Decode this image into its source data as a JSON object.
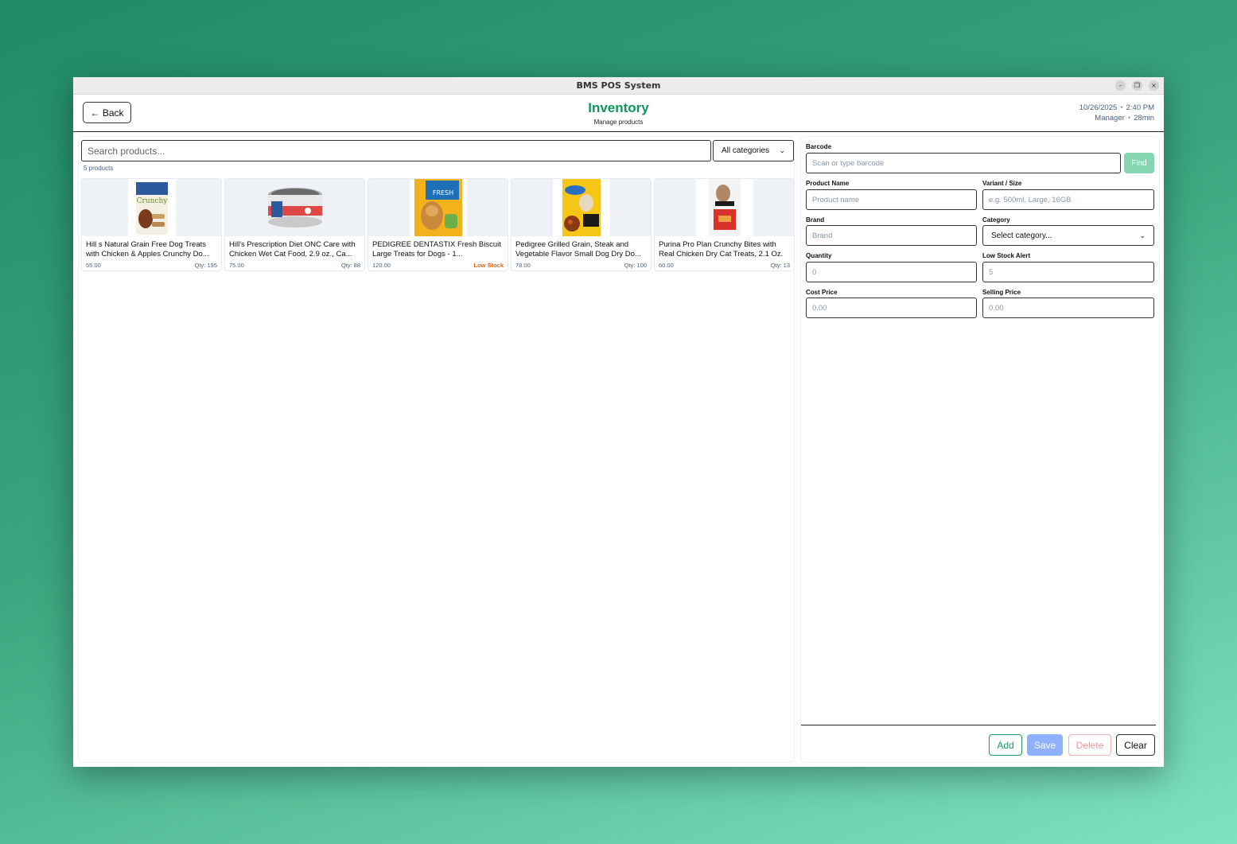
{
  "window": {
    "title": "BMS POS System",
    "controls": [
      "–",
      "❐",
      "×"
    ]
  },
  "header": {
    "back_label": "← Back",
    "title": "Inventory",
    "subtitle": "Manage products",
    "date": "10/26/2025",
    "time": "2:40 PM",
    "role": "Manager",
    "session": "28min",
    "accent_color": "#11955b"
  },
  "left": {
    "search_placeholder": "Search products...",
    "category_select": "All categories",
    "count_label": "5 products",
    "products": [
      {
        "name": "Hill s Natural Grain Free Dog Treats with Chicken & Apples Crunchy Do...",
        "price": "55.00",
        "qty": "Qty: 195",
        "low": false,
        "icon": "treat-bag-icon"
      },
      {
        "name": "Hill's Prescription Diet ONC Care with Chicken Wet Cat Food, 2.9 oz., Ca...",
        "price": "75.00",
        "qty": "Qty: 88",
        "low": false,
        "icon": "can-icon"
      },
      {
        "name": "PEDIGREE DENTASTIX Fresh Biscuit Large Treats for Dogs - 1...",
        "price": "120.00",
        "qty": "Low Stock",
        "low": true,
        "icon": "treat-bag-icon"
      },
      {
        "name": "Pedigree Grilled Grain, Steak and Vegetable Flavor Small Dog Dry Do...",
        "price": "78.00",
        "qty": "Qty: 100",
        "low": false,
        "icon": "food-bag-icon"
      },
      {
        "name": "Purina Pro Plan Crunchy Bites with Real Chicken Dry Cat Treats, 2.1 Oz.",
        "price": "60.00",
        "qty": "Qty: 13",
        "low": false,
        "icon": "treat-pouch-icon"
      }
    ]
  },
  "form": {
    "barcode_label": "Barcode",
    "barcode_placeholder": "Scan or type barcode",
    "find_label": "Find",
    "product_name_label": "Product Name",
    "product_name_placeholder": "Product name",
    "variant_label": "Variant / Size",
    "variant_placeholder": "e.g. 500ml, Large, 16GB",
    "brand_label": "Brand",
    "brand_placeholder": "Brand",
    "category_label": "Category",
    "category_value": "Select category...",
    "quantity_label": "Quantity",
    "quantity_placeholder": "0",
    "low_stock_label": "Low Stock Alert",
    "low_stock_placeholder": "5",
    "cost_label": "Cost Price",
    "cost_placeholder": "0.00",
    "selling_label": "Selling Price",
    "selling_placeholder": "0.00"
  },
  "actions": {
    "add": "Add",
    "save": "Save",
    "delete": "Delete",
    "clear": "Clear"
  }
}
